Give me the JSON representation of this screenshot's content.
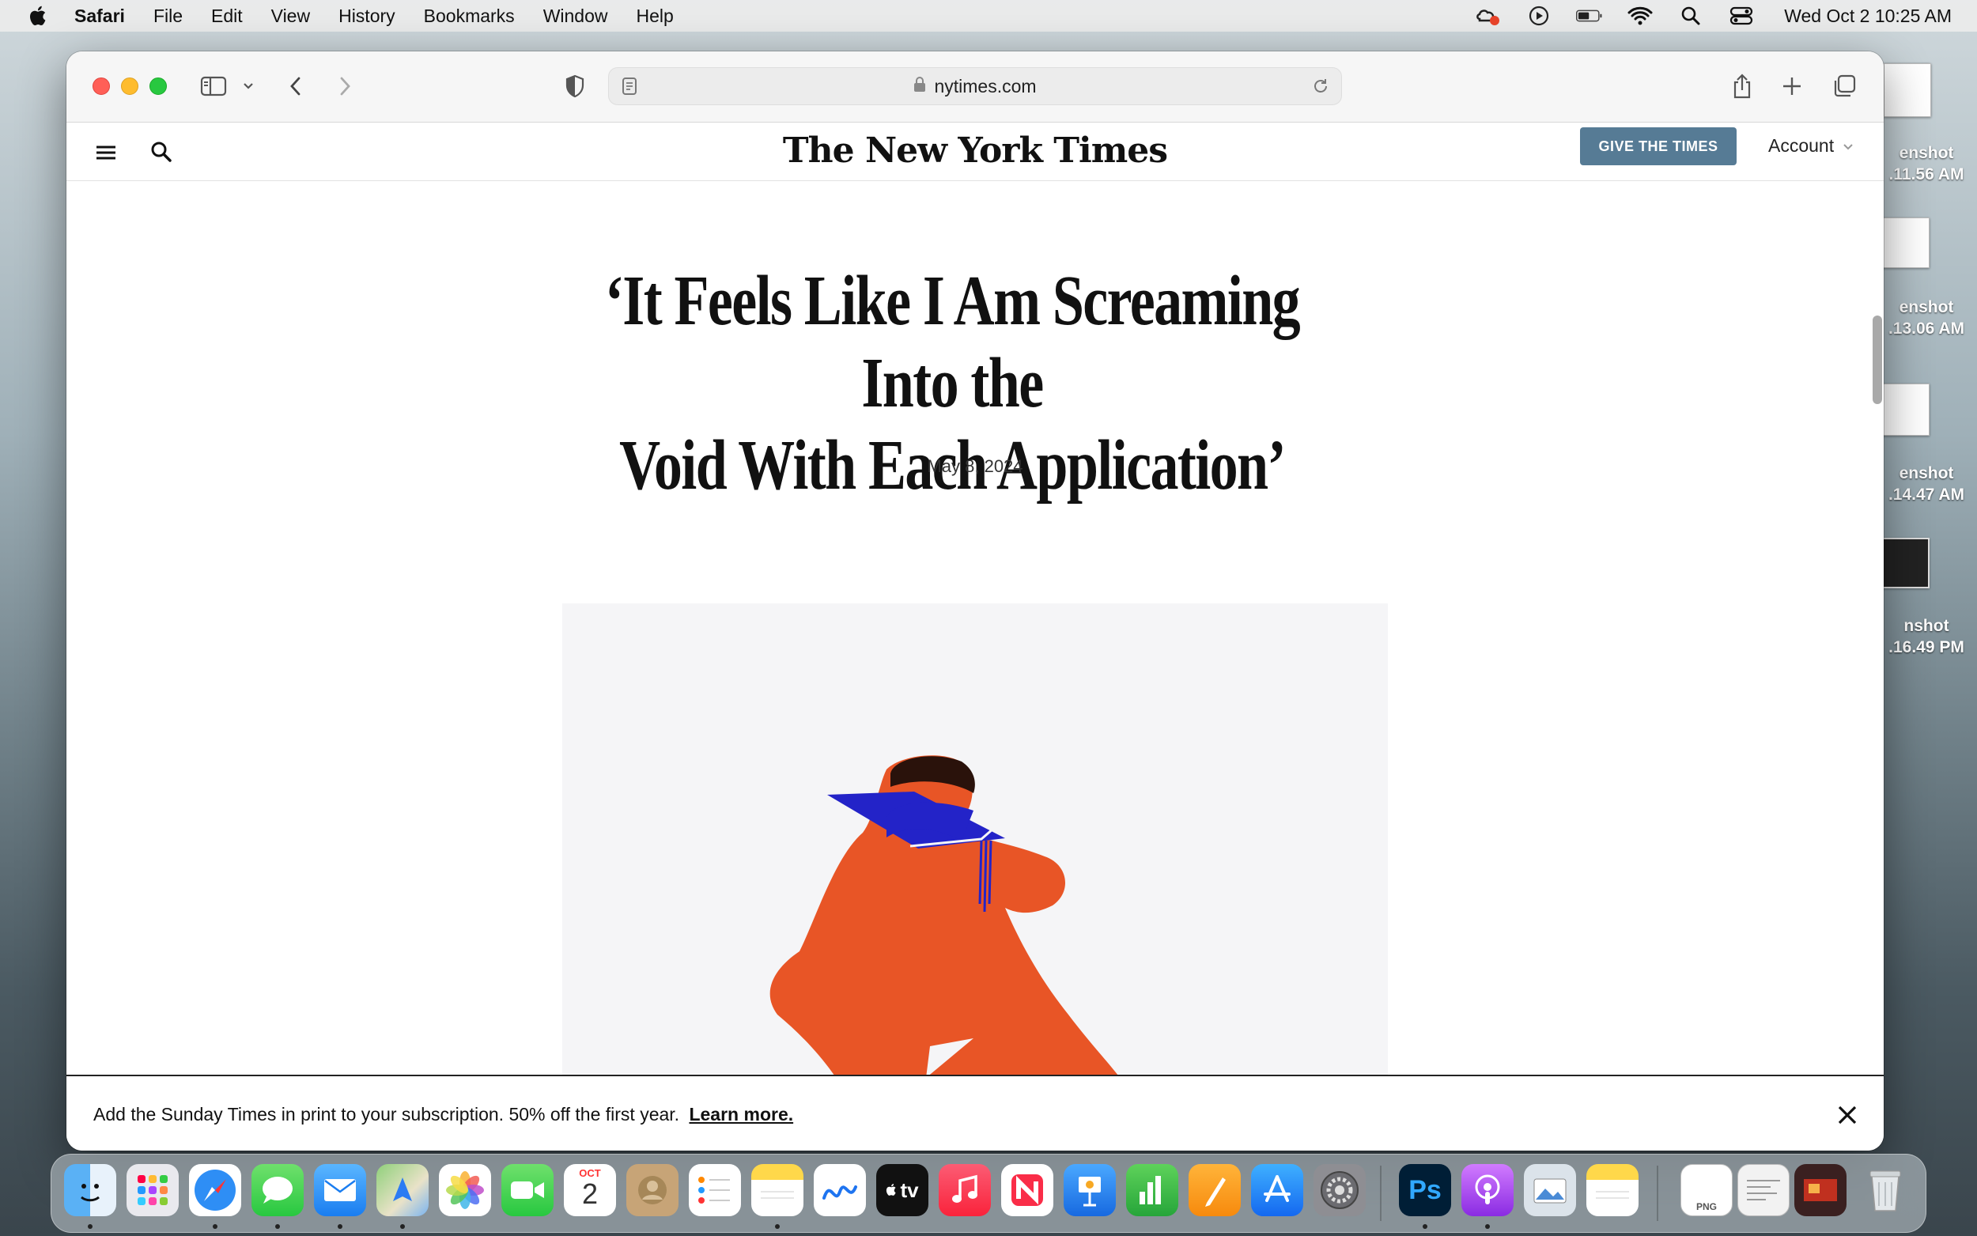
{
  "menubar": {
    "app_name": "Safari",
    "items": [
      "File",
      "Edit",
      "View",
      "History",
      "Bookmarks",
      "Window",
      "Help"
    ],
    "clock": "Wed Oct 2  10:25 AM"
  },
  "desktop": {
    "files": [
      {
        "name_line1": "enshot",
        "name_line2": ".11.56 AM"
      },
      {
        "name_line1": "enshot",
        "name_line2": ".13.06 AM"
      },
      {
        "name_line1": "enshot",
        "name_line2": ".14.47 AM"
      },
      {
        "name_line1": "nshot",
        "name_line2": ".16.49 PM"
      }
    ]
  },
  "browser": {
    "url": "nytimes.com"
  },
  "nyt": {
    "logo": "The New York Times",
    "give_button": "GIVE THE TIMES",
    "account": "Account"
  },
  "article": {
    "headline_line1": "‘It Feels Like I Am Screaming Into the",
    "headline_line2": "Void With Each Application’",
    "date": "May 8, 2024"
  },
  "banner": {
    "message": "Add the Sunday Times in print to your subscription. 50% off the first year.",
    "link": "Learn more."
  },
  "dock": {
    "calendar_month": "OCT",
    "calendar_day": "2",
    "tv_label": "tv",
    "ps_label": "Ps",
    "png_label": "PNG",
    "apps": [
      "finder",
      "launchpad",
      "safari",
      "messages",
      "mail",
      "maps",
      "photos",
      "facetime",
      "calendar",
      "contacts",
      "reminders",
      "notes",
      "freeform",
      "tv",
      "music",
      "news",
      "keynote",
      "numbers",
      "pages",
      "app-store",
      "system-settings",
      "photoshop",
      "podcasts",
      "preview",
      "notes-widget",
      "png-file",
      "documents",
      "photos-stack",
      "trash"
    ]
  },
  "colors": {
    "give_button_bg": "#567b95",
    "figure_orange": "#e85526",
    "cap_blue": "#2323c8"
  }
}
